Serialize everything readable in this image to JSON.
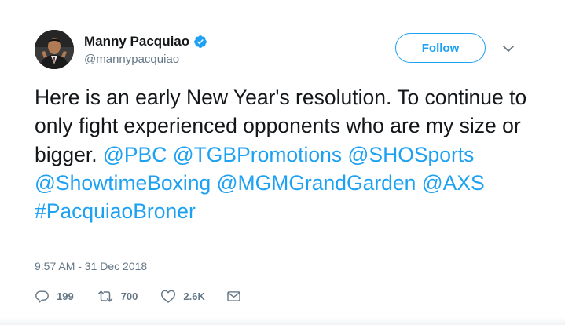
{
  "author": {
    "display_name": "Manny Pacquiao",
    "handle": "@mannypacquiao",
    "verified": true
  },
  "follow_button": {
    "label": "Follow"
  },
  "more_menu": {
    "icon": "chevron-down-icon"
  },
  "tweet": {
    "text_plain": "Here is an early New Year's resolution. To continue to only fight experienced opponents who are my size or bigger.",
    "mention_pbc": "@PBC",
    "mention_tgb": "@TGBPromotions",
    "mention_sho": "@SHOSports",
    "mention_showtime": "@ShowtimeBoxing",
    "mention_mgm": "@MGMGrandGarden",
    "mention_axs": "@AXS",
    "hashtag": "#PacquiaoBroner"
  },
  "timestamp": "9:57 AM - 31 Dec 2018",
  "actions": {
    "replies": "199",
    "retweets": "700",
    "likes": "2.6K"
  },
  "colors": {
    "accent": "#1da1f2",
    "text": "#14171a",
    "muted": "#657786"
  }
}
